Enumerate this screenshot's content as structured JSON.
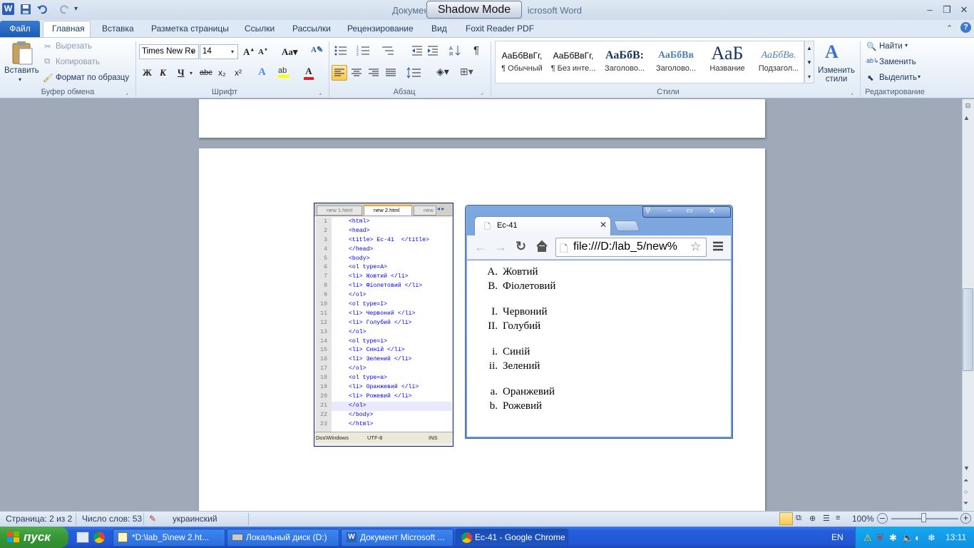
{
  "window": {
    "title_left": "Докумен",
    "title_right": "icrosoft Word",
    "shadow_mode": "Shadow Mode"
  },
  "ribbon": {
    "file_tab": "Файл",
    "tabs": [
      "Главная",
      "Вставка",
      "Разметка страницы",
      "Ссылки",
      "Рассылки",
      "Рецензирование",
      "Вид",
      "Foxit Reader PDF"
    ],
    "clipboard": {
      "paste": "Вставить",
      "cut": "Вырезать",
      "copy": "Копировать",
      "format_painter": "Формат по образцу",
      "group": "Буфер обмена"
    },
    "font": {
      "name": "Times New Ro",
      "size": "14",
      "bold": "Ж",
      "italic": "К",
      "underline": "Ч",
      "strike": "abc",
      "sub": "x₂",
      "sup": "x²",
      "group": "Шрифт"
    },
    "paragraph": {
      "group": "Абзац"
    },
    "styles": {
      "items": [
        {
          "preview": "АаБбВвГг,",
          "name": "¶ Обычный"
        },
        {
          "preview": "АаБбВвГг,",
          "name": "¶ Без инте..."
        },
        {
          "preview": "АаБбВ:",
          "name": "Заголово..."
        },
        {
          "preview": "АаБбВв",
          "name": "Заголово..."
        },
        {
          "preview": "АаБ",
          "name": "Название"
        },
        {
          "preview": "АаБбВв.",
          "name": "Подзагол..."
        }
      ],
      "change": "Изменить стили",
      "group": "Стили"
    },
    "editing": {
      "find": "Найти",
      "replace": "Заменить",
      "select": "Выделить",
      "group": "Редактирование"
    }
  },
  "notepad": {
    "tabs": [
      "new 1.html",
      "new 2.html",
      "new"
    ],
    "lines": [
      "<html>",
      "<head>",
      "<title> Ес-41  </title>",
      "</head>",
      "<body>",
      "<ol type=A>",
      "<li> Жовтий </li>",
      "<li> Фіолетовий </li>",
      "</ol>",
      "<ol type=I>",
      "<li> Червоний </li>",
      "<li> Голубий </li>",
      "</ol>",
      "<ol type=i>",
      "<li> Синій </li>",
      "<li> Зелений </li>",
      "</ol>",
      "<ol type=a>",
      "<li> Оранжевий </li>",
      "<li> Рожевий </li>",
      "</ol>",
      "</body>",
      "</html>"
    ],
    "status": [
      "Dos\\Windows",
      "UTF-8",
      "INS"
    ]
  },
  "chrome": {
    "tab_title": "Ес-41",
    "url": "file:///D:/lab_5/new%",
    "lists": [
      {
        "markers": [
          "A.",
          "B."
        ],
        "items": [
          "Жовтий",
          "Фіолетовий"
        ]
      },
      {
        "markers": [
          "I.",
          "II."
        ],
        "items": [
          "Червоний",
          "Голубий"
        ]
      },
      {
        "markers": [
          "i.",
          "ii."
        ],
        "items": [
          "Синій",
          "Зелений"
        ]
      },
      {
        "markers": [
          "a.",
          "b."
        ],
        "items": [
          "Оранжевий",
          "Рожевий"
        ]
      }
    ]
  },
  "statusbar": {
    "page": "Страница: 2 из 2",
    "words": "Число слов: 53",
    "language": "украинский",
    "zoom": "100%"
  },
  "taskbar": {
    "start": "пуск",
    "tasks": [
      "*D:\\lab_5\\new  2.ht...",
      "Локальный диск (D:)",
      "Документ Microsoft ...",
      "Ес-41 - Google Chrome"
    ],
    "lang": "EN",
    "clock": "13:11"
  }
}
